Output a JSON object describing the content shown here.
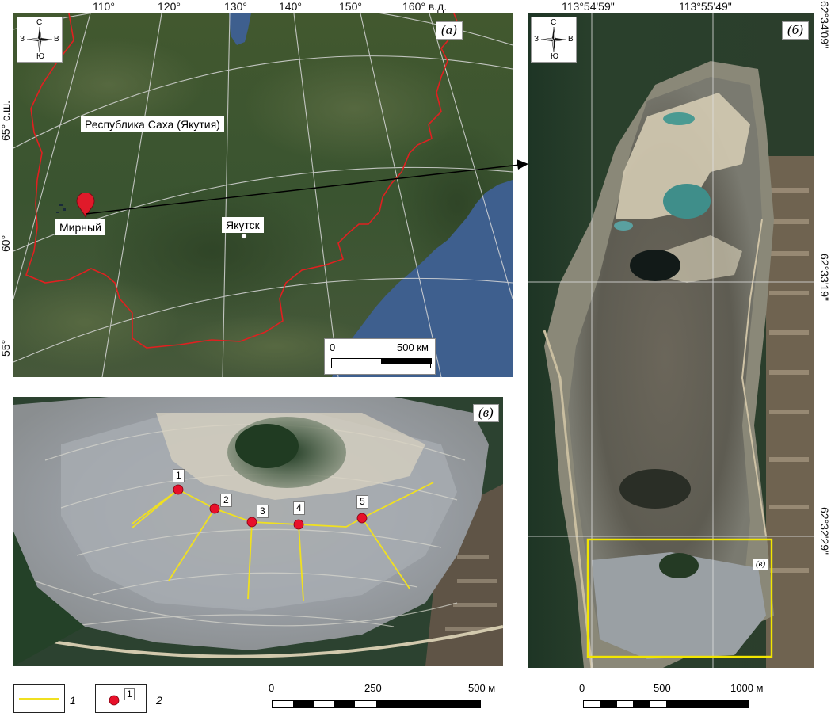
{
  "panel_a": {
    "tag": "(а)",
    "top_longitudes": [
      "110°",
      "120°",
      "130°",
      "140°",
      "150°",
      "160° в.д."
    ],
    "left_latitudes": [
      "65° с.ш.",
      "60°",
      "55°"
    ],
    "region_label": "Республика Саха (Якутия)",
    "city_mirny": "Мирный",
    "city_yakutsk": "Якутск",
    "scale_zero": "0",
    "scale_max": "500 км",
    "compass": {
      "n": "С",
      "s": "Ю",
      "w": "З",
      "e": "В"
    },
    "colors": {
      "border": "#e02020",
      "water": "#3e5f8e",
      "land": "#3b5430"
    }
  },
  "panel_b": {
    "tag": "(б)",
    "top_longitudes": [
      "113°54'59\"",
      "113°55'49\""
    ],
    "right_latitudes": [
      "62°34'09\"",
      "62°33'19\"",
      "62°32'29\""
    ],
    "inset_tag": "(в)",
    "compass": {
      "n": "С",
      "s": "Ю",
      "w": "З",
      "e": "В"
    },
    "scale_zero": "0",
    "scale_mid": "500",
    "scale_max": "1000 м",
    "colors": {
      "frame": "#f2e600"
    }
  },
  "panel_c": {
    "tag": "(в)",
    "points": [
      "1",
      "2",
      "3",
      "4",
      "5"
    ],
    "scale_zero": "0",
    "scale_mid": "250",
    "scale_max": "500 м",
    "colors": {
      "profile": "#f0e020",
      "point": "#e8102a"
    }
  },
  "legend": {
    "line_num": "1",
    "point_box_label": "1",
    "point_num": "2",
    "colors": {
      "line": "#f0e020",
      "point": "#e8102a"
    }
  }
}
